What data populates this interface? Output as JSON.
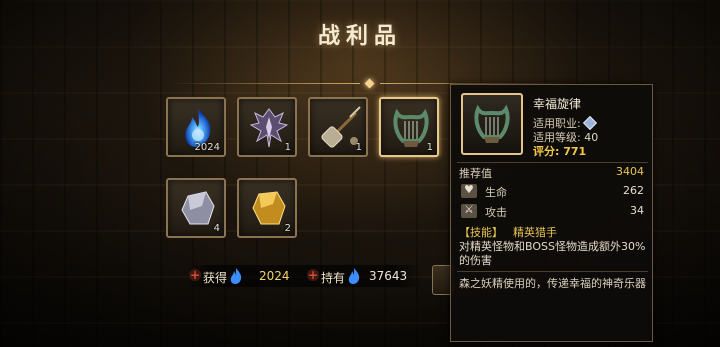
{
  "title": "战利品",
  "loot": [
    {
      "name": "蓝色火焰",
      "icon": "blue-flame-icon",
      "count": "2024"
    },
    {
      "name": "暗影羽翼",
      "icon": "shadow-wing-icon",
      "count": "1"
    },
    {
      "name": "战锤",
      "icon": "mace-icon",
      "count": "1"
    },
    {
      "name": "幸福旋律",
      "icon": "lyre-icon",
      "count": "1"
    },
    {
      "name": "银矿石",
      "icon": "silver-ore-icon",
      "count": "4"
    },
    {
      "name": "金矿石",
      "icon": "gold-ore-icon",
      "count": "2"
    }
  ],
  "resources": {
    "gain_label": "获得",
    "gain_value": "2024",
    "own_label": "持有",
    "own_value": "37643"
  },
  "tooltip": {
    "name": "幸福旋律",
    "job_label": "适用职业:",
    "level_label": "适用等级:",
    "level_value": "40",
    "score_label": "评分:",
    "score_value": "771",
    "recommend_label": "推荐值",
    "recommend_value": "3404",
    "stats": [
      {
        "label": "生命",
        "value": "262",
        "icon": "heart-icon"
      },
      {
        "label": "攻击",
        "value": "34",
        "icon": "sword-icon"
      }
    ],
    "skill_tag": "【技能】",
    "skill_name": "精英猎手",
    "skill_desc": "对精英怪物和BOSS怪物造成额外30%的伤害",
    "flavor": "森之妖精使用的，传递幸福的神奇乐器"
  },
  "colors": {
    "accent_gold": "#e8c450",
    "frame": "#8a7350",
    "selected_frame": "#e8c88b"
  }
}
